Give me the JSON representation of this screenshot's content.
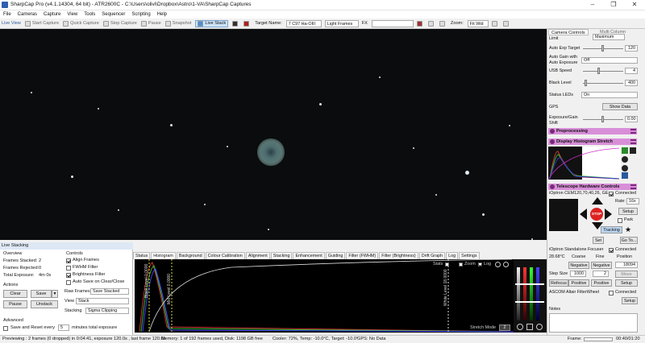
{
  "window": {
    "title": "SharpCap Pro (v4.1.14304, 64 bit) - ATR2600C - C:\\Users\\olivi\\Dropbox\\Astro\\1-VA\\SharpCap Captures",
    "minimize": "–",
    "maximize": "❐",
    "close": "✕"
  },
  "menu": [
    "File",
    "Cameras",
    "Capture",
    "View",
    "Tools",
    "Sequencer",
    "Scripting",
    "Help"
  ],
  "toolbar": {
    "live_view": "Live View",
    "start_capture": "Start Capture",
    "quick_capture": "Quick Capture",
    "stop_capture": "Stop Capture",
    "pause": "Pause",
    "snapshot": "Snapshot",
    "live_stack": "Live Stack",
    "target_label": "Target Name:",
    "target_value": "7 C97 Ha-OIII",
    "frame_type": "Light Frames",
    "fx_label": "FX",
    "zoom_label": "Zoom:",
    "zoom_value": "Fit Wid"
  },
  "right_panel": {
    "tab_camera": "Camera Controls",
    "tab_multi": "Multi Column",
    "limit_label": "Limit",
    "limit_value": "Maximum",
    "auto_exp_target_label": "Auto Exp Target",
    "auto_exp_target_value": "120",
    "auto_gain_label": "Auto Gain with Auto Exposure",
    "auto_gain_value": "Off",
    "usb_speed_label": "USB Speed",
    "usb_speed_value": "4",
    "black_level_label": "Black Level",
    "black_level_value": "400",
    "status_leds_label": "Status LEDs",
    "status_leds_value": "On",
    "gps_label": "GPS",
    "gps_button": "Show Data",
    "exposure_shift_label": "Exposure/Gain Shift",
    "exposure_shift_value": "0.00",
    "preprocessing": "Preprocessing",
    "display_histogram": "Display Histogram Stretch",
    "telescope_hw": "Telescope Hardware Controls",
    "mount_name": "iOptron CEM120,70,40,26, GE",
    "mount_connected": "Connected",
    "rate_label": "Rate:",
    "rate_value": "16x",
    "setup": "Setup",
    "stop": "STOP",
    "park": "Park",
    "tracking": "Tracking",
    "set": "Set",
    "goto": "Go To...",
    "focuser_name": "iOptron Standalone Focuser",
    "focuser_connected": "Connected",
    "focuser_temp": "28.68°C",
    "coarse": "Coarse",
    "fine": "Fine",
    "position": "Position",
    "negative": "Negative",
    "positive": "Positive",
    "position_value": "18094",
    "step_size_label": "Step Size",
    "step_size_value": "1000",
    "step_small": "2",
    "move": "Move",
    "refocus": "Refocus",
    "filterwheel": "ASCOM Altair FilterWheel",
    "fw_connected": "Connected",
    "notes_label": "Notes"
  },
  "live_stacking": {
    "header": "Live Stacking",
    "overview": "Overview",
    "frames_stacked_label": "Frames Stacked:",
    "frames_stacked": "2",
    "frames_rejected_label": "Frames Rejected:",
    "frames_rejected": "0",
    "total_exposure_label": "Total Exposure:",
    "total_exposure": "4m 0s",
    "actions": "Actions",
    "clear": "Clear",
    "save": "Save",
    "pause": "Pause",
    "unstack": "Unstack",
    "controls": "Controls",
    "align_frames": "Align Frames",
    "fwhm_filter": "FWHM Filter",
    "brightness_filter": "Brightness Filter",
    "auto_save": "Auto Save on Clear/Close",
    "raw_frames_label": "Raw Frames",
    "raw_frames_value": "Save Stacked",
    "view_label": "View",
    "view_value": "Stack",
    "stacking_label": "Stacking",
    "stacking_value": "Sigma Clipping",
    "advanced": "Advanced",
    "save_reset": "Save and Reset every",
    "save_reset_value": "5",
    "save_reset_unit": "minutes total exposure"
  },
  "tabs": [
    "Status",
    "Histogram",
    "Background",
    "Colour Calibration",
    "Alignment",
    "Stacking",
    "Enhancement",
    "Guiding",
    "Filter (FWHM)",
    "Filter (Brightness)",
    "Drift Graph",
    "Log",
    "Settings"
  ],
  "histogram": {
    "stats": "Stats",
    "zoom": "Zoom",
    "log": "Log",
    "black_level": "Black Level 0.0000",
    "mid_level": "Mid Level 0.0000",
    "white_level": "White Level 18.0000",
    "stretch_mode": "Stretch Mode",
    "stretch_value": "2"
  },
  "status_bar": {
    "preview": "Previewing : 2 frames (0 dropped) in 0:04:41, exposure 120.0s , last frame 120.0s",
    "memory": "Memory: 1 of 192 frames used, Disk: 1198 GB free",
    "cooler": "Cooler: 72%, Temp: -10.0°C, Target: -10.0°",
    "gps": "GPS: No Data",
    "frame_label": "Frame:",
    "time": "00:40/01:20"
  },
  "colors": {
    "accent": "#d88fd8",
    "nebula": "#5a7673",
    "live_stack_bg": "#cde4f7"
  }
}
